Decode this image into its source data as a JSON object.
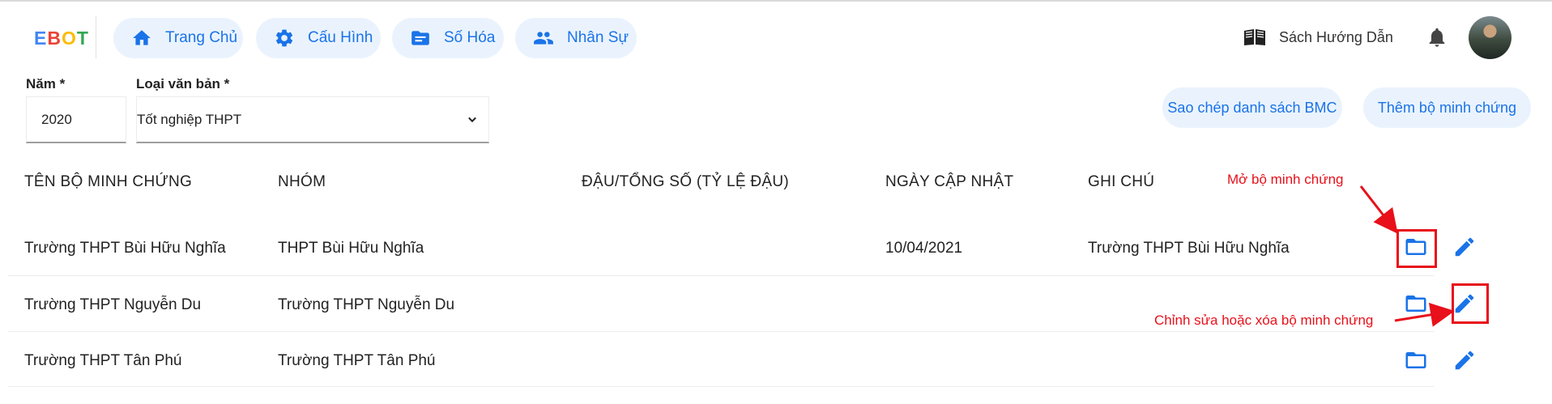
{
  "header": {
    "logo": [
      "E",
      "B",
      "O",
      "T"
    ],
    "nav": [
      {
        "label": "Trang Chủ",
        "icon": "home-icon"
      },
      {
        "label": "Cấu Hình",
        "icon": "gear-icon"
      },
      {
        "label": "Số Hóa",
        "icon": "folder-text-icon"
      },
      {
        "label": "Nhân Sự",
        "icon": "people-icon"
      }
    ],
    "guide_label": "Sách Hướng Dẫn",
    "guide_icon": "book-icon",
    "bell_icon": "bell-icon"
  },
  "filters": {
    "year": {
      "label": "Năm *",
      "value": "2020"
    },
    "doc_type": {
      "label": "Loại văn bản *",
      "value": "Tốt nghiệp THPT"
    }
  },
  "actions": {
    "copy_label": "Sao chép danh sách BMC",
    "add_label": "Thêm bộ minh chứng"
  },
  "table": {
    "headers": [
      "TÊN BỘ MINH CHỨNG",
      "NHÓM",
      "ĐẬU/TỔNG SỐ (TỶ LỆ ĐẬU)",
      "NGÀY CẬP NHẬT",
      "GHI CHÚ"
    ],
    "rows": [
      {
        "name": "Trường THPT Bùi Hữu Nghĩa",
        "group": "THPT Bùi Hữu Nghĩa",
        "pass": "",
        "updated": "10/04/2021",
        "note": "Trường THPT Bùi Hữu Nghĩa"
      },
      {
        "name": "Trường THPT Nguyễn Du",
        "group": "Trường THPT Nguyễn Du",
        "pass": "",
        "updated": "",
        "note": ""
      },
      {
        "name": "Trường THPT Tân Phú",
        "group": "Trường THPT Tân Phú",
        "pass": "",
        "updated": "",
        "note": ""
      }
    ]
  },
  "annotations": {
    "open_label": "Mở bộ minh chứng",
    "edit_label": "Chỉnh sửa hoặc xóa bộ minh chứng",
    "color": "#e8101a"
  },
  "colors": {
    "accent": "#1a73e8",
    "pill_bg": "#eaf3fd"
  }
}
